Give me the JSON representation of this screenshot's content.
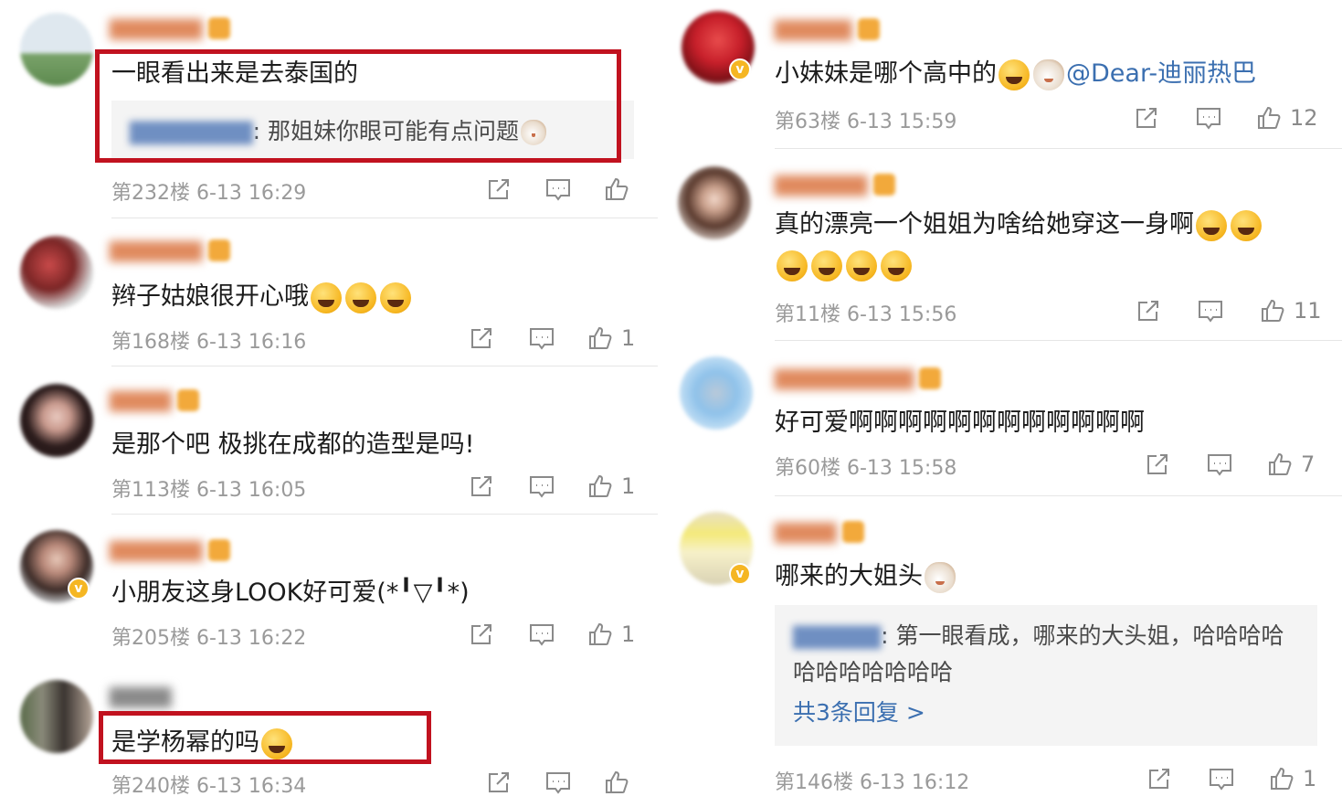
{
  "colors": {
    "highlight_red": "#c1121f",
    "mention_blue": "#3b6fb0",
    "meta_gray": "#9a9a9a",
    "quote_bg": "#f4f4f4"
  },
  "icons": [
    "share-icon",
    "comment-icon",
    "like-icon",
    "vip-badge-icon",
    "verified-icon",
    "emoji-icon"
  ],
  "left_column": {
    "comments": [
      {
        "text": "一眼看出来是去泰国的",
        "quote_text": ": 那姐妹你眼可能有点问题",
        "meta": "第232楼 6-13 16:29",
        "likes": ""
      },
      {
        "text": "辫子姑娘很开心哦",
        "meta": "第168楼 6-13 16:16",
        "likes": "1"
      },
      {
        "text": "是那个吧 极挑在成都的造型是吗!",
        "meta": "第113楼 6-13 16:05",
        "likes": "1"
      },
      {
        "text": "小朋友这身LOOK好可爱(*╹▽╹*)",
        "meta": "第205楼 6-13 16:22",
        "likes": "1"
      },
      {
        "text": "是学杨幂的吗",
        "meta": "第240楼 6-13 16:34",
        "likes": ""
      }
    ]
  },
  "right_column": {
    "comments": [
      {
        "text": "小妹妹是哪个高中的",
        "mention": "@Dear-迪丽热巴",
        "meta": "第63楼 6-13 15:59",
        "likes": "12"
      },
      {
        "text": "真的漂亮一个姐姐为啥给她穿这一身啊",
        "meta": "第11楼 6-13 15:56",
        "likes": "11"
      },
      {
        "text": "好可爱啊啊啊啊啊啊啊啊啊啊啊啊",
        "meta": "第60楼 6-13 15:58",
        "likes": "7"
      },
      {
        "text": "哪来的大姐头",
        "quote_text": ": 第一眼看成，哪来的大头姐，哈哈哈哈哈哈哈哈哈哈哈",
        "more_replies": "共3条回复 >",
        "meta": "第146楼 6-13 16:12",
        "likes": "1"
      }
    ]
  }
}
